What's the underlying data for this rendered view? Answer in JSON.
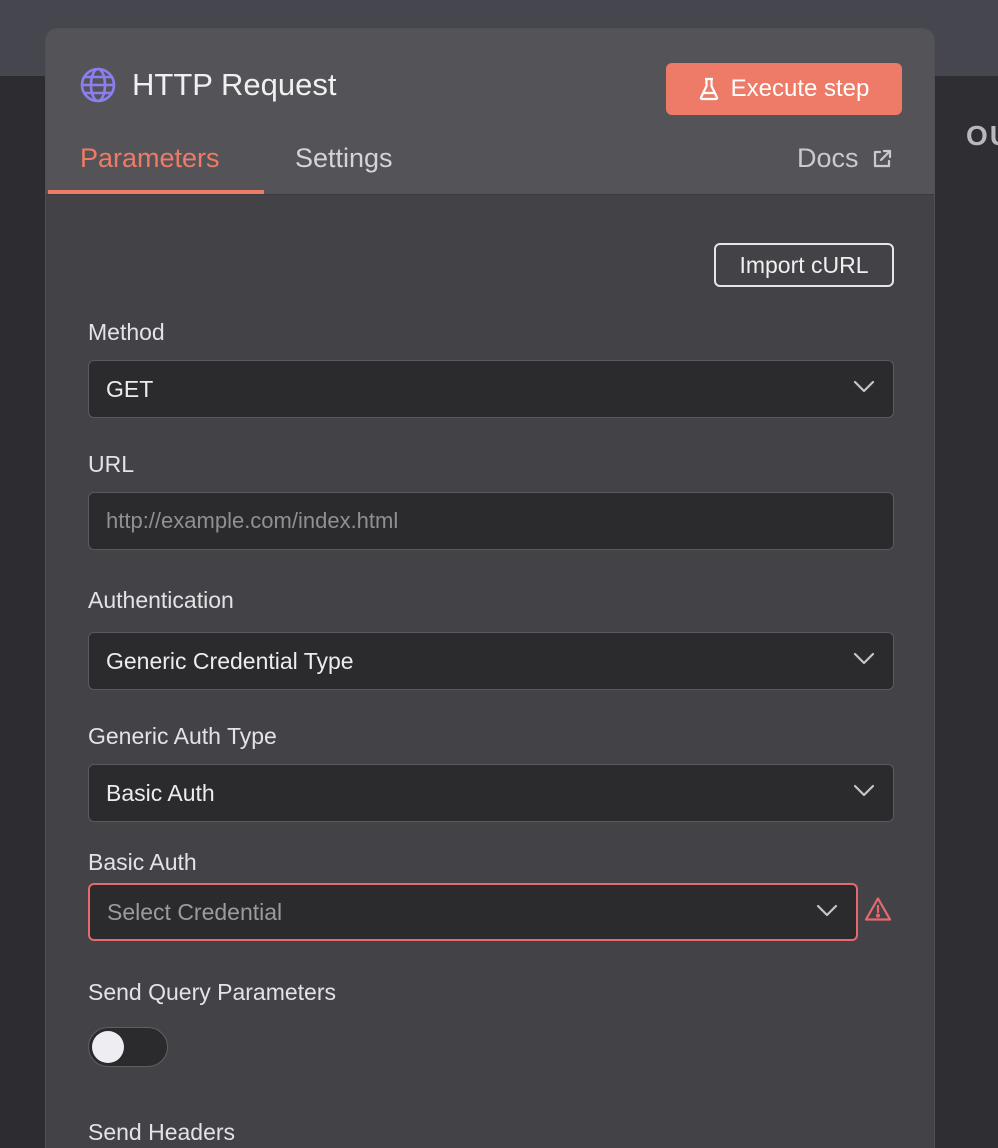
{
  "right_panel": {
    "label": "OU"
  },
  "node": {
    "title": "HTTP Request",
    "icon": "globe-icon",
    "execute_label": "Execute step",
    "execute_icon": "flask-icon"
  },
  "tabs": [
    {
      "label": "Parameters",
      "active": true
    },
    {
      "label": "Settings",
      "active": false
    }
  ],
  "docs": {
    "label": "Docs",
    "icon": "external-link-icon"
  },
  "import_curl_label": "Import cURL",
  "fields": {
    "method": {
      "label": "Method",
      "value": "GET"
    },
    "url": {
      "label": "URL",
      "value": "",
      "placeholder": "http://example.com/index.html"
    },
    "authentication": {
      "label": "Authentication",
      "value": "Generic Credential Type"
    },
    "generic_auth_type": {
      "label": "Generic Auth Type",
      "value": "Basic Auth"
    },
    "basic_auth": {
      "label": "Basic Auth",
      "placeholder": "Select Credential",
      "status": "warning-icon"
    },
    "send_query_parameters": {
      "label": "Send Query Parameters",
      "enabled": false
    },
    "send_headers": {
      "label": "Send Headers"
    }
  },
  "colors": {
    "accent": "#ee7b67",
    "error": "#e36a6e",
    "icon_purple": "#8b7ff0"
  }
}
